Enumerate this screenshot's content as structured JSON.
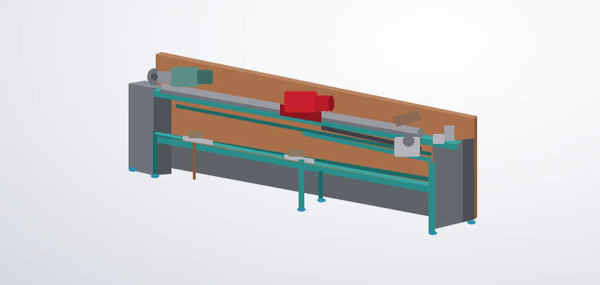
{
  "viewport": {
    "background": {
      "center": "#ffffff",
      "edge": "#d6d9e0"
    }
  },
  "model": {
    "colors": {
      "back_panel": "#a8704a",
      "back_panel_top": "#b98560",
      "back_panel_end": "#8a5a3a",
      "side_panel": "#6e7279",
      "side_panel_dark": "#4f535a",
      "frame_steel": "#2b8d8a",
      "frame_steel_dark": "#1c6a68",
      "roller": "#9a9ca2",
      "roller_shadow": "#6f7278",
      "carriage": "#c8202c",
      "carriage_dark": "#8e141d",
      "motor": "#5c8f86",
      "motor_dark": "#3f6a62",
      "feet": "#2f8fb0",
      "parts_grey": "#b3b5ba",
      "strap": "#8a6a55"
    }
  }
}
